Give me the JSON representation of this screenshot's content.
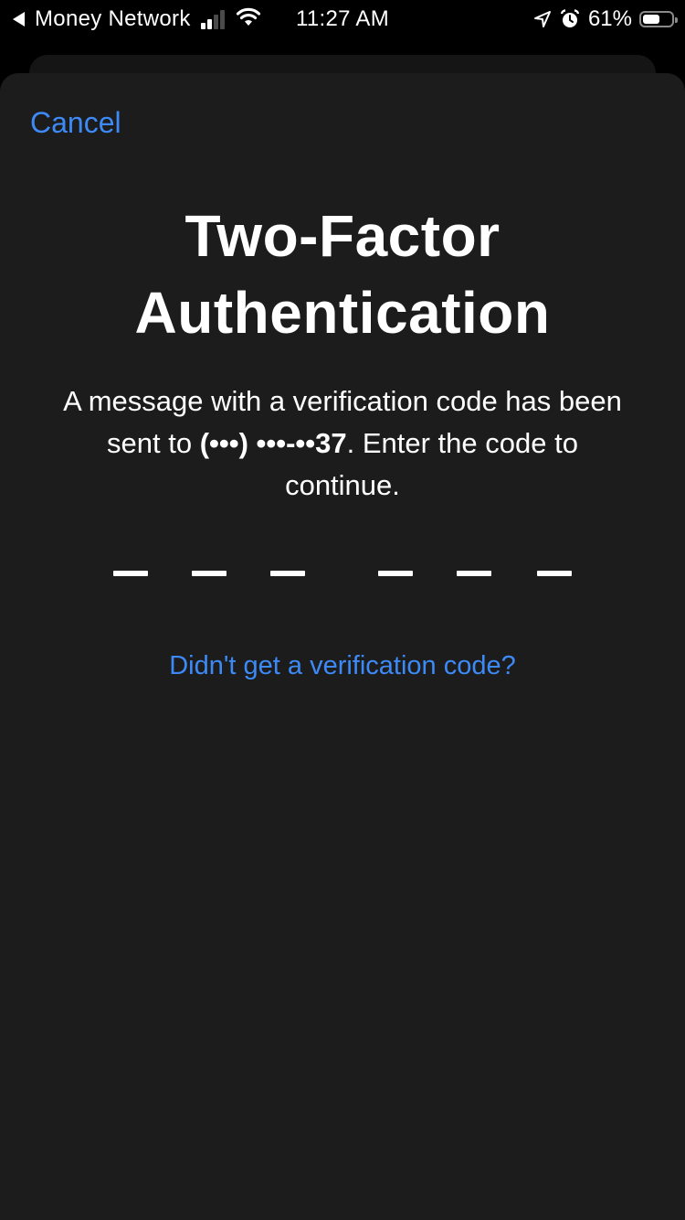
{
  "status_bar": {
    "back_app": "Money Network",
    "time": "11:27 AM",
    "battery_percent_label": "61%",
    "battery_level": 0.61,
    "signal_bars_active": 2,
    "signal_bars_total": 4,
    "icons": [
      "back-arrow-icon",
      "cellular-signal-icon",
      "wifi-icon",
      "location-arrow-icon",
      "alarm-clock-icon",
      "battery-icon"
    ]
  },
  "sheet": {
    "cancel_label": "Cancel",
    "title_line1": "Two-Factor",
    "title_line2": "Authentication",
    "message": {
      "prefix": "A message with a verification code has been sent to ",
      "phone_masked_prefix": "(•••) •••-••",
      "phone_last_digits": "37",
      "suffix": ". Enter the code to continue."
    },
    "code_length": 6,
    "code_value": "",
    "resend_link": "Didn't get a verification code?"
  },
  "colors": {
    "accent": "#3d8af7",
    "sheet_background": "#1c1c1c",
    "screen_background": "#000000",
    "text": "#ffffff"
  }
}
